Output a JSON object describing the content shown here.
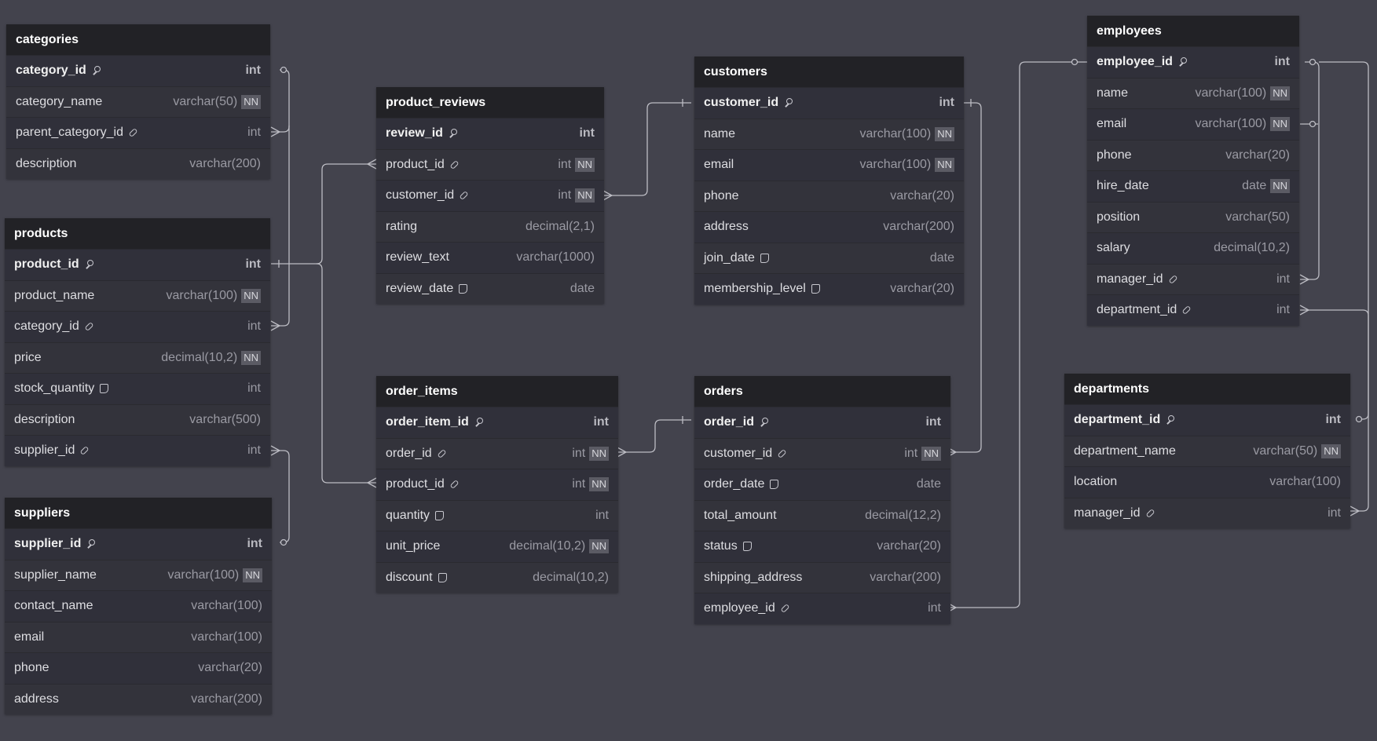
{
  "tables": [
    {
      "id": "categories",
      "name": "categories",
      "fields": [
        {
          "name": "category_id",
          "type": "int",
          "pk": true,
          "icon": "key-icon"
        },
        {
          "name": "category_name",
          "type": "varchar(50)",
          "nn": true
        },
        {
          "name": "parent_category_id",
          "type": "int",
          "icon": "link-icon"
        },
        {
          "name": "description",
          "type": "varchar(200)"
        }
      ]
    },
    {
      "id": "products",
      "name": "products",
      "fields": [
        {
          "name": "product_id",
          "type": "int",
          "pk": true,
          "icon": "key-icon"
        },
        {
          "name": "product_name",
          "type": "varchar(100)",
          "nn": true
        },
        {
          "name": "category_id",
          "type": "int",
          "icon": "link-icon"
        },
        {
          "name": "price",
          "type": "decimal(10,2)",
          "nn": true
        },
        {
          "name": "stock_quantity",
          "type": "int",
          "icon": "note-icon"
        },
        {
          "name": "description",
          "type": "varchar(500)"
        },
        {
          "name": "supplier_id",
          "type": "int",
          "icon": "link-icon"
        }
      ]
    },
    {
      "id": "suppliers",
      "name": "suppliers",
      "fields": [
        {
          "name": "supplier_id",
          "type": "int",
          "pk": true,
          "icon": "key-icon"
        },
        {
          "name": "supplier_name",
          "type": "varchar(100)",
          "nn": true
        },
        {
          "name": "contact_name",
          "type": "varchar(100)"
        },
        {
          "name": "email",
          "type": "varchar(100)"
        },
        {
          "name": "phone",
          "type": "varchar(20)"
        },
        {
          "name": "address",
          "type": "varchar(200)"
        }
      ]
    },
    {
      "id": "product_reviews",
      "name": "product_reviews",
      "fields": [
        {
          "name": "review_id",
          "type": "int",
          "pk": true,
          "icon": "key-icon"
        },
        {
          "name": "product_id",
          "type": "int",
          "nn": true,
          "icon": "link-icon"
        },
        {
          "name": "customer_id",
          "type": "int",
          "nn": true,
          "icon": "link-icon"
        },
        {
          "name": "rating",
          "type": "decimal(2,1)"
        },
        {
          "name": "review_text",
          "type": "varchar(1000)"
        },
        {
          "name": "review_date",
          "type": "date",
          "icon": "note-icon"
        }
      ]
    },
    {
      "id": "order_items",
      "name": "order_items",
      "fields": [
        {
          "name": "order_item_id",
          "type": "int",
          "pk": true,
          "icon": "key-icon"
        },
        {
          "name": "order_id",
          "type": "int",
          "nn": true,
          "icon": "link-icon"
        },
        {
          "name": "product_id",
          "type": "int",
          "nn": true,
          "icon": "link-icon"
        },
        {
          "name": "quantity",
          "type": "int",
          "icon": "note-icon"
        },
        {
          "name": "unit_price",
          "type": "decimal(10,2)",
          "nn": true
        },
        {
          "name": "discount",
          "type": "decimal(10,2)",
          "icon": "note-icon"
        }
      ]
    },
    {
      "id": "customers",
      "name": "customers",
      "fields": [
        {
          "name": "customer_id",
          "type": "int",
          "pk": true,
          "icon": "key-icon"
        },
        {
          "name": "name",
          "type": "varchar(100)",
          "nn": true
        },
        {
          "name": "email",
          "type": "varchar(100)",
          "nn": true
        },
        {
          "name": "phone",
          "type": "varchar(20)"
        },
        {
          "name": "address",
          "type": "varchar(200)"
        },
        {
          "name": "join_date",
          "type": "date",
          "icon": "note-icon"
        },
        {
          "name": "membership_level",
          "type": "varchar(20)",
          "icon": "note-icon"
        }
      ]
    },
    {
      "id": "orders",
      "name": "orders",
      "fields": [
        {
          "name": "order_id",
          "type": "int",
          "pk": true,
          "icon": "key-icon"
        },
        {
          "name": "customer_id",
          "type": "int",
          "nn": true,
          "icon": "link-icon"
        },
        {
          "name": "order_date",
          "type": "date",
          "icon": "note-icon"
        },
        {
          "name": "total_amount",
          "type": "decimal(12,2)"
        },
        {
          "name": "status",
          "type": "varchar(20)",
          "icon": "note-icon"
        },
        {
          "name": "shipping_address",
          "type": "varchar(200)"
        },
        {
          "name": "employee_id",
          "type": "int",
          "icon": "link-icon"
        }
      ]
    },
    {
      "id": "employees",
      "name": "employees",
      "fields": [
        {
          "name": "employee_id",
          "type": "int",
          "pk": true,
          "icon": "key-icon"
        },
        {
          "name": "name",
          "type": "varchar(100)",
          "nn": true
        },
        {
          "name": "email",
          "type": "varchar(100)",
          "nn": true
        },
        {
          "name": "phone",
          "type": "varchar(20)"
        },
        {
          "name": "hire_date",
          "type": "date",
          "nn": true
        },
        {
          "name": "position",
          "type": "varchar(50)"
        },
        {
          "name": "salary",
          "type": "decimal(10,2)"
        },
        {
          "name": "manager_id",
          "type": "int",
          "icon": "link-icon"
        },
        {
          "name": "department_id",
          "type": "int",
          "icon": "link-icon"
        }
      ]
    },
    {
      "id": "departments",
      "name": "departments",
      "fields": [
        {
          "name": "department_id",
          "type": "int",
          "pk": true,
          "icon": "key-icon"
        },
        {
          "name": "department_name",
          "type": "varchar(50)",
          "nn": true
        },
        {
          "name": "location",
          "type": "varchar(100)"
        },
        {
          "name": "manager_id",
          "type": "int",
          "icon": "link-icon"
        }
      ]
    }
  ],
  "nn_label": "NN",
  "colors": {
    "background": "#43434d",
    "header": "#222226",
    "row": "#33333b",
    "line": "#bdbdc4"
  }
}
